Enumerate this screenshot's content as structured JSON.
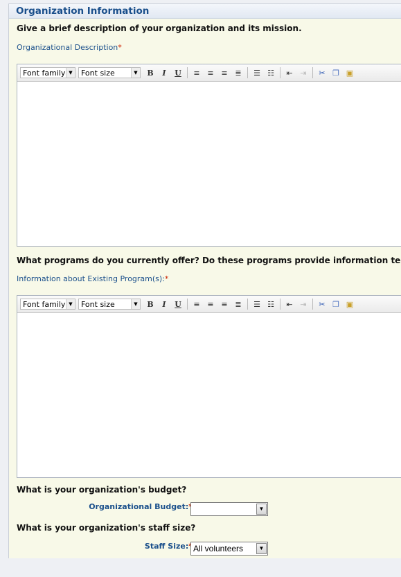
{
  "header": {
    "title": "Organization Information"
  },
  "section1": {
    "question": "Give a brief description of your organization and its mission.",
    "label": "Organizational Description",
    "required": "*"
  },
  "section2": {
    "question": "What programs do you currently offer? Do these programs provide information tech",
    "label": "Information about Existing Program(s):",
    "required": "*"
  },
  "toolbar": {
    "font_family": "Font family",
    "font_size": "Font size",
    "bold": "B",
    "italic": "I",
    "underline": "U"
  },
  "budget": {
    "question": "What is your organization's budget?",
    "label": "Organizational Budget:",
    "required": "*",
    "value": ""
  },
  "staff": {
    "question": "What is your organization's staff size?",
    "label": "Staff Size:",
    "required": "*",
    "value": "All volunteers"
  }
}
